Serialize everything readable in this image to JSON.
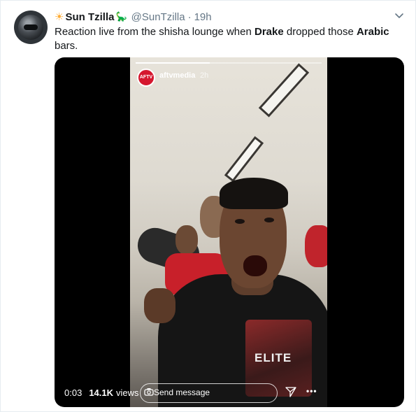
{
  "tweet": {
    "author_name": "Sun Tzilla",
    "author_handle": "@SunTzilla",
    "separator": "·",
    "timestamp": "19h",
    "text_parts": {
      "p1": "Reaction live from the shisha lounge when ",
      "b1": "Drake",
      "p2": " dropped those ",
      "b2": "Arabic",
      "p3": " bars."
    }
  },
  "icons": {
    "name_prefix": "sun-emoji",
    "name_suffix": "dinosaur-emoji",
    "menu": "chevron-down-icon",
    "camera": "camera-icon",
    "share": "send-icon",
    "more": "more-icon"
  },
  "video": {
    "time": "0:03",
    "views": "14.1K",
    "views_label": "views"
  },
  "story": {
    "username": "aftvmedia",
    "age": "2h",
    "avatar_text": "AFTV",
    "send_message": "Send message",
    "shirt_text": "ELITE",
    "progress": 0.4
  },
  "colors": {
    "text_primary": "#14171a",
    "text_secondary": "#657786",
    "border": "#e6ecf0",
    "media_bg": "#000000"
  }
}
